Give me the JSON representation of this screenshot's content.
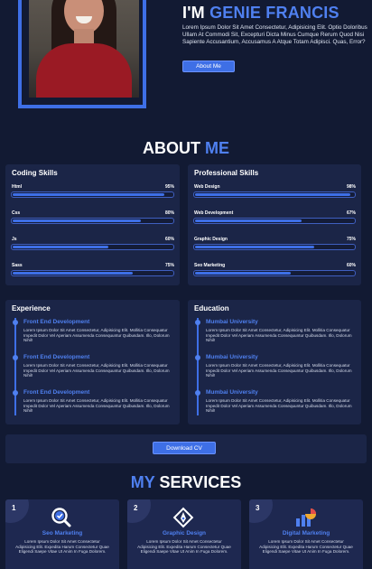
{
  "hero": {
    "title_prefix": "I'M",
    "name": "GENIE FRANCIS",
    "description": "Lorem Ipsum Dolor Sit Amet Consectetur, Adipisicing Elit. Optio Doloribus Ullam At Commodi Sit, Excepturi Dicta Minus Cumque Rerum Quod Nisi Sapiente Accusantium, Accusamus A Atque Totam Adipisci. Quas, Error?",
    "about_button": "About Me"
  },
  "about": {
    "title_white": "ABOUT",
    "title_blue": "ME"
  },
  "coding_skills": {
    "title": "Coding Skills",
    "items": [
      {
        "name": "Html",
        "percent_label": "95%",
        "percent": 95
      },
      {
        "name": "Css",
        "percent_label": "80%",
        "percent": 80
      },
      {
        "name": "Js",
        "percent_label": "60%",
        "percent": 60
      },
      {
        "name": "Sass",
        "percent_label": "75%",
        "percent": 75
      }
    ]
  },
  "professional_skills": {
    "title": "Professional Skills",
    "items": [
      {
        "name": "Web Design",
        "percent_label": "98%",
        "percent": 98
      },
      {
        "name": "Web Development",
        "percent_label": "67%",
        "percent": 67
      },
      {
        "name": "Graphic Design",
        "percent_label": "75%",
        "percent": 75
      },
      {
        "name": "Seo Marketing",
        "percent_label": "60%",
        "percent": 60
      }
    ]
  },
  "experience": {
    "title": "Experience",
    "entries": [
      {
        "title": "Front End Development",
        "text": "Lorem Ipsum Dolor Sit Amet Consectetur, Adipisicing Elit. Mollitia Consequatur Impedit Dolor Vel Aperiam Assumenda Consequuntur Quibusdam. Illo, Dolorum Nihil!"
      },
      {
        "title": "Front End Development",
        "text": "Lorem Ipsum Dolor Sit Amet Consectetur, Adipisicing Elit. Mollitia Consequatur Impedit Dolor Vel Aperiam Assumenda Consequuntur Quibusdam. Illo, Dolorum Nihil!"
      },
      {
        "title": "Front End Development",
        "text": "Lorem Ipsum Dolor Sit Amet Consectetur, Adipisicing Elit. Mollitia Consequatur Impedit Dolor Vel Aperiam Assumenda Consequuntur Quibusdam. Illo, Dolorum Nihil!"
      }
    ]
  },
  "education": {
    "title": "Education",
    "entries": [
      {
        "title": "Mumbai University",
        "text": "Lorem Ipsum Dolor Sit Amet Consectetur, Adipisicing Elit. Mollitia Consequatur Impedit Dolor Vel Aperiam Assumenda Consequuntur Quibusdam. Illo, Dolorum Nihil!"
      },
      {
        "title": "Mumbai University",
        "text": "Lorem Ipsum Dolor Sit Amet Consectetur, Adipisicing Elit. Mollitia Consequatur Impedit Dolor Vel Aperiam Assumenda Consequuntur Quibusdam. Illo, Dolorum Nihil!"
      },
      {
        "title": "Mumbai University",
        "text": "Lorem Ipsum Dolor Sit Amet Consectetur, Adipisicing Elit. Mollitia Consequatur Impedit Dolor Vel Aperiam Assumenda Consequuntur Quibusdam. Illo, Dolorum Nihil!"
      }
    ]
  },
  "download_cv": "Download CV",
  "services": {
    "title_blue": "MY",
    "title_white": "SERVICES",
    "items": [
      {
        "number": "1",
        "icon": "seo-search-icon",
        "title": "Seo Marketing",
        "text": "Lorem Ipsum Dolor Sit Amet Consectetur Adipisicing Elit. Expedita Harum Consectetur Quae Eligendi Saepe Vitae Ut Anim In Fuga Dolorem."
      },
      {
        "number": "2",
        "icon": "graphic-design-icon",
        "title": "Graphic Design",
        "text": "Lorem Ipsum Dolor Sit Amet Consectetur Adipisicing Elit. Expedita Harum Consectetur Quae Eligendi Saepe Vitae Ut Anim In Fuga Dolorem."
      },
      {
        "number": "3",
        "icon": "chart-icon",
        "title": "Digital Marketing",
        "text": "Lorem Ipsum Dolor Sit Amet Consectetur Adipisicing Elit. Expedita Harum Consectetur Quae Eligendi Saepe Vitae Ut Anim In Fuga Dolorem."
      }
    ]
  },
  "colors": {
    "background": "#121a33",
    "card": "#1b2547",
    "accent": "#3e6fe6",
    "accent_text": "#4f80f0"
  }
}
